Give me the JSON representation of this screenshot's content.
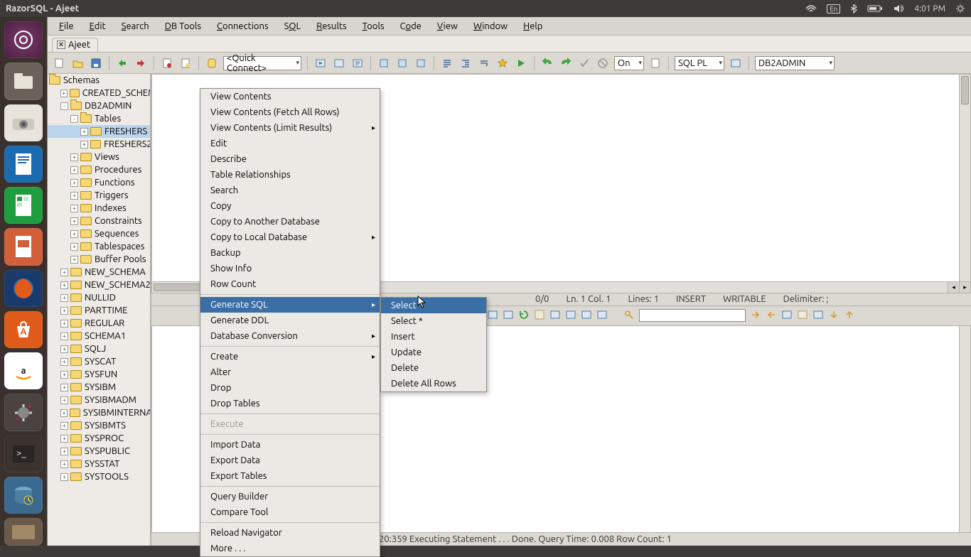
{
  "panel": {
    "title": "RazorSQL - Ajeet",
    "lang": "En",
    "time": "4:01 PM"
  },
  "menubar": [
    "File",
    "Edit",
    "Search",
    "DB Tools",
    "Connections",
    "SQL",
    "Results",
    "Tools",
    "Code",
    "View",
    "Window",
    "Help"
  ],
  "tab": {
    "label": "Ajeet"
  },
  "toolbar": {
    "quick_connect": "<Quick Connect>",
    "on_label": "On",
    "lang_combo": "SQL PL",
    "schema_combo": "DB2ADMIN"
  },
  "tree": {
    "root": "Schemas",
    "items": [
      {
        "depth": 1,
        "tw": "+",
        "label": "CREATED_SCHEMA"
      },
      {
        "depth": 1,
        "tw": "-",
        "label": "DB2ADMIN",
        "open": true
      },
      {
        "depth": 2,
        "tw": "-",
        "label": "Tables",
        "open": true
      },
      {
        "depth": 3,
        "tw": "+",
        "label": "FRESHERS",
        "sel": true
      },
      {
        "depth": 3,
        "tw": "+",
        "label": "FRESHERS2"
      },
      {
        "depth": 2,
        "tw": "+",
        "label": "Views"
      },
      {
        "depth": 2,
        "tw": "+",
        "label": "Procedures"
      },
      {
        "depth": 2,
        "tw": "+",
        "label": "Functions"
      },
      {
        "depth": 2,
        "tw": "+",
        "label": "Triggers"
      },
      {
        "depth": 2,
        "tw": "+",
        "label": "Indexes"
      },
      {
        "depth": 2,
        "tw": "+",
        "label": "Constraints"
      },
      {
        "depth": 2,
        "tw": "+",
        "label": "Sequences"
      },
      {
        "depth": 2,
        "tw": "+",
        "label": "Tablespaces"
      },
      {
        "depth": 2,
        "tw": "+",
        "label": "Buffer Pools"
      },
      {
        "depth": 1,
        "tw": "+",
        "label": "NEW_SCHEMA"
      },
      {
        "depth": 1,
        "tw": "+",
        "label": "NEW_SCHEMA2"
      },
      {
        "depth": 1,
        "tw": "+",
        "label": "NULLID"
      },
      {
        "depth": 1,
        "tw": "+",
        "label": "PARTTIME"
      },
      {
        "depth": 1,
        "tw": "+",
        "label": "REGULAR"
      },
      {
        "depth": 1,
        "tw": "+",
        "label": "SCHEMA1"
      },
      {
        "depth": 1,
        "tw": "+",
        "label": "SQLJ"
      },
      {
        "depth": 1,
        "tw": "+",
        "label": "SYSCAT"
      },
      {
        "depth": 1,
        "tw": "+",
        "label": "SYSFUN"
      },
      {
        "depth": 1,
        "tw": "+",
        "label": "SYSIBM"
      },
      {
        "depth": 1,
        "tw": "+",
        "label": "SYSIBMADM"
      },
      {
        "depth": 1,
        "tw": "+",
        "label": "SYSIBMINTERNAL"
      },
      {
        "depth": 1,
        "tw": "+",
        "label": "SYSIBMTS"
      },
      {
        "depth": 1,
        "tw": "+",
        "label": "SYSPROC"
      },
      {
        "depth": 1,
        "tw": "+",
        "label": "SYSPUBLIC"
      },
      {
        "depth": 1,
        "tw": "+",
        "label": "SYSSTAT"
      },
      {
        "depth": 1,
        "tw": "+",
        "label": "SYSTOOLS"
      }
    ]
  },
  "context_menu": [
    {
      "label": "View Contents"
    },
    {
      "label": "View Contents (Fetch All Rows)"
    },
    {
      "label": "View Contents (Limit Results)",
      "sub": true
    },
    {
      "label": "Edit"
    },
    {
      "label": "Describe"
    },
    {
      "label": "Table Relationships"
    },
    {
      "label": "Search"
    },
    {
      "label": "Copy"
    },
    {
      "label": "Copy to Another Database"
    },
    {
      "label": "Copy to Local Database",
      "sub": true
    },
    {
      "label": "Backup"
    },
    {
      "label": "Show Info"
    },
    {
      "label": "Row Count"
    },
    {
      "div": true
    },
    {
      "label": "Generate SQL",
      "sub": true,
      "hl": true
    },
    {
      "label": "Generate DDL"
    },
    {
      "label": "Database Conversion",
      "sub": true
    },
    {
      "div": true
    },
    {
      "label": "Create",
      "sub": true
    },
    {
      "label": "Alter"
    },
    {
      "label": "Drop"
    },
    {
      "label": "Drop Tables"
    },
    {
      "div": true
    },
    {
      "label": "Execute",
      "disabled": true
    },
    {
      "div": true
    },
    {
      "label": "Import Data"
    },
    {
      "label": "Export Data"
    },
    {
      "label": "Export Tables"
    },
    {
      "div": true
    },
    {
      "label": "Query Builder"
    },
    {
      "label": "Compare Tool"
    },
    {
      "div": true
    },
    {
      "label": "Reload Navigator"
    },
    {
      "label": "More . . ."
    }
  ],
  "submenu": [
    {
      "label": "Select",
      "hl": true
    },
    {
      "label": "Select *"
    },
    {
      "label": "Insert"
    },
    {
      "label": "Update"
    },
    {
      "label": "Delete"
    },
    {
      "label": "Delete All Rows"
    }
  ],
  "status": {
    "ratio": "0/0",
    "pos": "Ln. 1 Col. 1",
    "lines": "Lines: 1",
    "mode": "INSERT",
    "rw": "WRITABLE",
    "delim": "Delimiter: ;"
  },
  "bottom_status": "20:359 Executing Statement . . . Done. Query Time: 0.008   Row Count: 1"
}
